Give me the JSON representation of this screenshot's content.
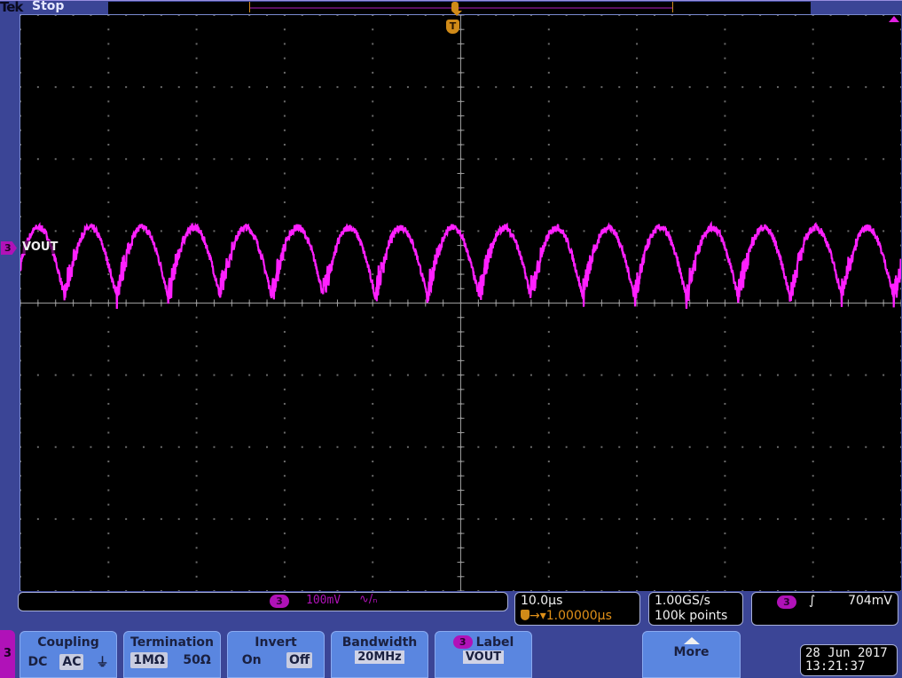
{
  "header": {
    "brand": "Tek",
    "run_state": "Stop"
  },
  "waveform": {
    "channel": "3",
    "label": "VOUT",
    "color": "#ff20ff",
    "ripple_periods": 17,
    "ripple_peak_div": 1.05,
    "ripple_trough_div": 0.1
  },
  "graticule": {
    "h_divisions": 10,
    "v_divisions": 8
  },
  "channel_readout": {
    "badge": "3",
    "scale": "100mV",
    "bw_limit_icon": "bandwidth-limit-icon",
    "bw_symbol": "∿/ₙ"
  },
  "horizontal": {
    "time_per_div": "10.0µs",
    "delay": "1.00000µs",
    "delay_prefix": "→▾"
  },
  "acquisition": {
    "sample_rate": "1.00GS/s",
    "record_length": "100k points"
  },
  "trigger": {
    "badge": "3",
    "slope": "∫",
    "level": "704mV"
  },
  "trigger_marker": {
    "label": "T"
  },
  "menu": {
    "channel_tab": "3",
    "coupling": {
      "title": "Coupling",
      "options": [
        "DC",
        "AC",
        "⏚"
      ],
      "selected": "AC"
    },
    "termination": {
      "title": "Termination",
      "options": [
        "1MΩ",
        "50Ω"
      ],
      "selected": "1MΩ"
    },
    "invert": {
      "title": "Invert",
      "options": [
        "On",
        "Off"
      ],
      "selected": "Off"
    },
    "bandwidth": {
      "title": "Bandwidth",
      "value": "20MHz"
    },
    "label": {
      "badge": "3",
      "title": "Label",
      "value": "VOUT"
    },
    "more": {
      "title": "More"
    }
  },
  "datetime": {
    "date": "28 Jun 2017",
    "time": "13:21:37"
  }
}
